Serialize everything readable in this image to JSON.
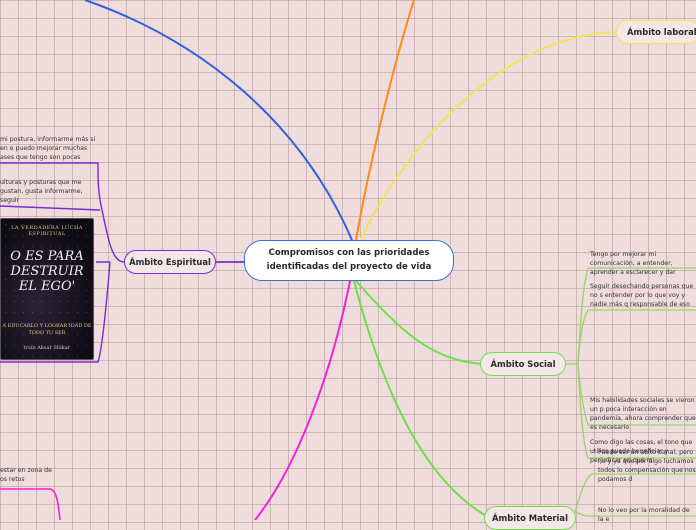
{
  "central": {
    "line1": "Compromisos con las prioridades",
    "line2": "identificadas del proyecto de vida"
  },
  "branches": {
    "laboral": "Ámbito laboral",
    "espiritual": "Ámbito Espiritual",
    "social": "Ámbito Social",
    "material": "Ámbito Material"
  },
  "leaves": {
    "esp1": "mi postura, informarme más si en e puedo mejorar muchas ases que tengo son pocas",
    "esp2": "ulturas y posturas que me gustan, gusta informarme, seguir",
    "esp3": "estar en zona de os retos",
    "soc1": "Tengo por mejorar mi comunicación, a entender, aprender a esclarecer y dar",
    "soc2": "Seguir desechando personas que no s entender por lo que voy y nadie más q responsable de eso",
    "soc3": "Mis habilidades sociales se vieron un p poca interacción en pandemia, ahora comprender que es necesario",
    "soc4": "Como digo las cosas, el tono que utilizo puede beneficiar y perjudicar en que m",
    "mat1": "Puede ser un abito banal, pero no y ya que por algo luchamos todos lo compensación que nos podamos d",
    "mat2": "No lo veo por la moralidad de la e"
  },
  "book": {
    "top": "LA VERDADERA LUCHA ESPIRITUAL",
    "title": "O ES PARA DESTRUIR EL EGO'",
    "sub": "A EDUCARLO Y LOGRAR IDAD DE TODO TU SER",
    "author": "trsin Aksar Shikar"
  },
  "colors": {
    "blue": "#2e63d6",
    "orange": "#ff8a1c",
    "yellow": "#f3e35a",
    "green": "#6fe04a",
    "magenta": "#f224d8",
    "purple": "#7a2bd6",
    "lightgreen": "#9ad46a"
  }
}
